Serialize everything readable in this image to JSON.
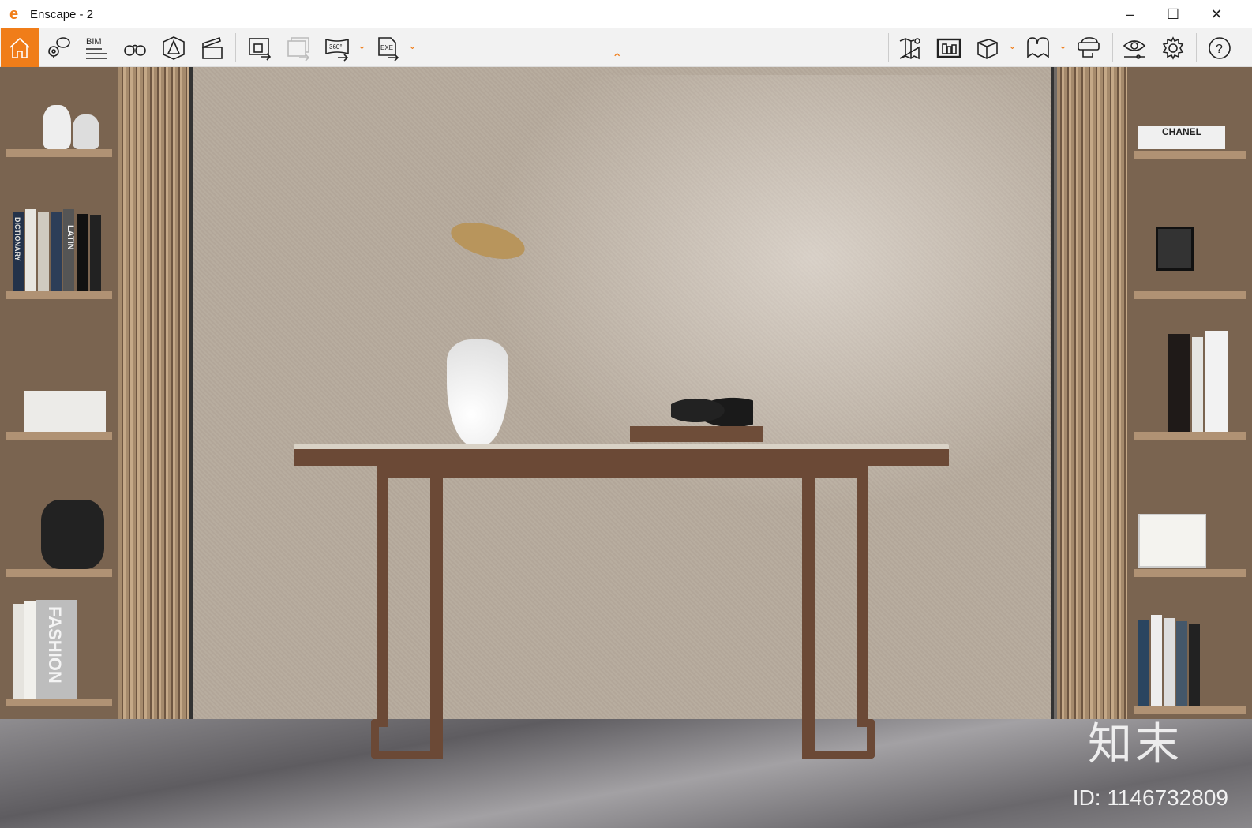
{
  "window": {
    "title": "Enscape - 2",
    "logo": "enscape-logo",
    "controls": [
      "minimize",
      "maximize",
      "close"
    ]
  },
  "toolbar": {
    "left": [
      {
        "icon": "home-icon",
        "active": true
      },
      {
        "icon": "location-comment-icon"
      },
      {
        "icon": "bim-icon",
        "label": "BIM"
      },
      {
        "icon": "binoculars-icon"
      },
      {
        "icon": "section-view-icon"
      },
      {
        "icon": "clapperboard-icon"
      },
      {
        "icon": "render-export-icon"
      },
      {
        "icon": "batch-render-icon",
        "disabled": true
      },
      {
        "icon": "panorama-360-icon",
        "label": "360°",
        "dropdown": true
      },
      {
        "icon": "exe-export-icon",
        "label": "EXE",
        "dropdown": true
      }
    ],
    "right": [
      {
        "icon": "map-icon"
      },
      {
        "icon": "asset-library-icon"
      },
      {
        "icon": "cube-view-icon",
        "dropdown": true
      },
      {
        "icon": "material-icon",
        "dropdown": true
      },
      {
        "icon": "vr-headset-icon"
      },
      {
        "icon": "visual-settings-icon"
      },
      {
        "icon": "settings-gear-icon"
      },
      {
        "icon": "help-icon",
        "label": "?"
      }
    ],
    "accent": "#f07d19"
  },
  "scene": {
    "book_labels": [
      "CHANEL",
      "FASHION",
      "LATIN",
      "DICTIONARY"
    ],
    "watermark": {
      "brand": "知末",
      "id": "ID: 1146732809"
    }
  }
}
